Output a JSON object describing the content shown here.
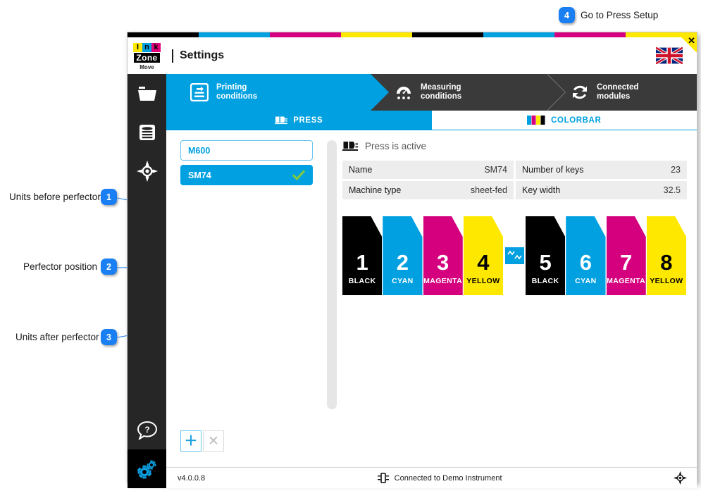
{
  "annotations": {
    "items": [
      {
        "number": "1",
        "label": "Units before perfector"
      },
      {
        "number": "2",
        "label": "Perfector position"
      },
      {
        "number": "3",
        "label": "Units after perfector"
      },
      {
        "number": "4",
        "label": "Go to Press Setup"
      }
    ]
  },
  "window": {
    "close_label": "✕",
    "cmyk_strip": [
      "#000000",
      "#00a0e1",
      "#d4007d",
      "#ffe800",
      "#000000",
      "#00a0e1",
      "#d4007d",
      "#ffe800"
    ]
  },
  "header": {
    "logo": {
      "letters": [
        {
          "char": "I",
          "bg": "#ffe800"
        },
        {
          "char": "n",
          "bg": "#00a0e1"
        },
        {
          "char": "k",
          "bg": "#e2007a"
        }
      ],
      "wordmark": "Zone",
      "subtitle": "Move"
    },
    "title": "Settings",
    "language_icon": "uk-flag-icon"
  },
  "sidebar": {
    "items": [
      {
        "name": "folder-icon",
        "label": "Jobs"
      },
      {
        "name": "database-icon",
        "label": "Database"
      },
      {
        "name": "registration-target-icon",
        "label": "Registration"
      },
      {
        "name": "help-icon",
        "label": "Help"
      },
      {
        "name": "settings-gears-icon",
        "label": "Settings"
      }
    ]
  },
  "steps": [
    {
      "label_line1": "Printing",
      "label_line2": "conditions",
      "icon": "printing-conditions-icon",
      "active": true
    },
    {
      "label_line1": "Measuring",
      "label_line2": "conditions",
      "icon": "measuring-conditions-icon",
      "active": false
    },
    {
      "label_line1": "Connected",
      "label_line2": "modules",
      "icon": "connected-modules-icon",
      "active": false
    }
  ],
  "tabs": [
    {
      "label": "PRESS",
      "icon": "press-icon",
      "active": true
    },
    {
      "label": "COLORBAR",
      "icon": "colorbar-icon",
      "active": false
    }
  ],
  "press_list": [
    {
      "name": "M600",
      "selected": false
    },
    {
      "name": "SM74",
      "selected": true
    }
  ],
  "left_buttons": {
    "add_label": "＋",
    "delete_label": "✕"
  },
  "press_details": {
    "status_text": "Press is active",
    "rows_left": [
      {
        "label": "Name",
        "value": "SM74"
      },
      {
        "label": "Machine type",
        "value": "sheet-fed"
      }
    ],
    "rows_right": [
      {
        "label": "Number of keys",
        "value": "23"
      },
      {
        "label": "Key width",
        "value": "32.5"
      }
    ]
  },
  "print_units": {
    "before_perfector": [
      {
        "number": "1",
        "color_name": "BLACK",
        "ink": "k"
      },
      {
        "number": "2",
        "color_name": "CYAN",
        "ink": "c"
      },
      {
        "number": "3",
        "color_name": "MAGENTA",
        "ink": "m"
      },
      {
        "number": "4",
        "color_name": "YELLOW",
        "ink": "y"
      }
    ],
    "perfector": {
      "name": "perfector-icon",
      "position_after_unit": "4"
    },
    "after_perfector": [
      {
        "number": "5",
        "color_name": "BLACK",
        "ink": "k"
      },
      {
        "number": "6",
        "color_name": "CYAN",
        "ink": "c"
      },
      {
        "number": "7",
        "color_name": "MAGENTA",
        "ink": "m"
      },
      {
        "number": "8",
        "color_name": "YELLOW",
        "ink": "y"
      }
    ]
  },
  "status_bar": {
    "version": "v4.0.0.8",
    "connection": "Connected to Demo Instrument"
  },
  "colors": {
    "cyan": "#00a0e1",
    "magenta": "#d4007d",
    "yellow": "#ffe800",
    "black": "#000000",
    "callout_blue": "#1a7ff2",
    "dark_nav": "#3a3a3a",
    "sidebar": "#262626"
  }
}
